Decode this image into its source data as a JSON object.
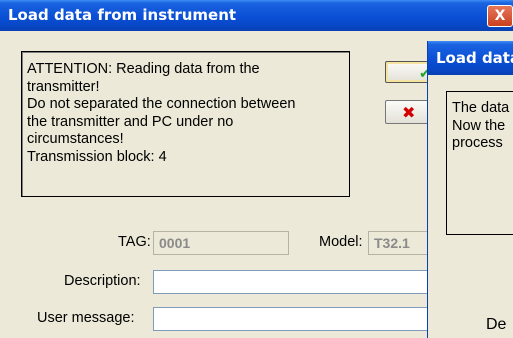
{
  "main_window": {
    "title": "Load data from instrument",
    "close_glyph": "X",
    "message_lines": [
      "ATTENTION: Reading data from the",
      "transmitter!",
      "Do not separated the connection between",
      "the transmitter and PC under no",
      "circumstances!",
      "Transmission block: 4"
    ],
    "ok_icon": "checkmark-icon",
    "cancel_icon": "red-x-icon",
    "tag_label": "TAG:",
    "tag_value": "0001",
    "model_label": "Model:",
    "model_value": "T32.1",
    "description_label": "Description:",
    "description_value": "",
    "user_message_label": "User message:",
    "user_message_value": ""
  },
  "second_window": {
    "title": "Load data",
    "message_lines": [
      "The data",
      "Now the",
      "process"
    ],
    "description_label": "De"
  },
  "colors": {
    "titlebar": "#0a4fd6",
    "window_bg": "#ece9d8",
    "close_button": "#c9401e",
    "cancel_x": "#d40000",
    "ok_check": "#2aa12a"
  }
}
